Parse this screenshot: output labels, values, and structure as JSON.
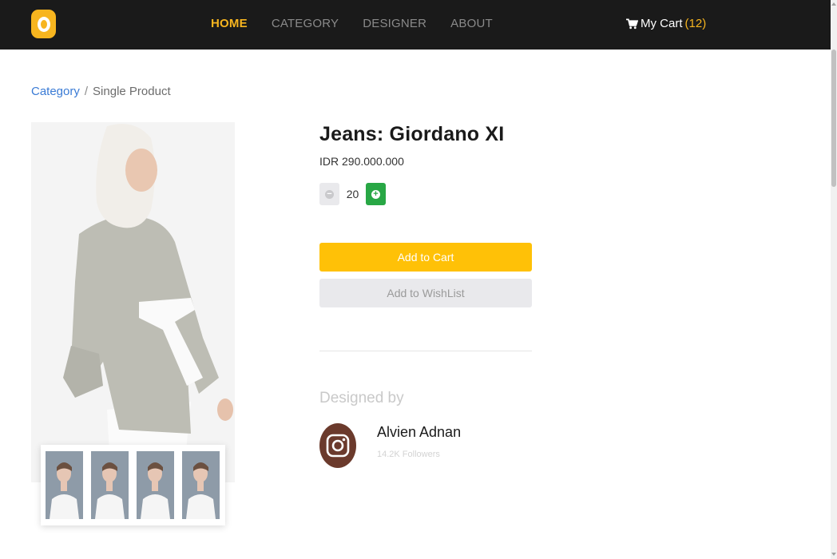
{
  "nav": {
    "links": [
      {
        "label": "HOME",
        "active": true
      },
      {
        "label": "CATEGORY",
        "active": false
      },
      {
        "label": "DESIGNER",
        "active": false
      },
      {
        "label": "ABOUT",
        "active": false
      }
    ],
    "cart_label": "My Cart",
    "cart_open": "(",
    "cart_count": "12",
    "cart_close": ")"
  },
  "breadcrumb": {
    "parent": "Category",
    "separator": "/",
    "current": "Single Product"
  },
  "product": {
    "title": "Jeans: Giordano XI",
    "price": "IDR 290.000.000",
    "quantity": "20",
    "add_to_cart": "Add to Cart",
    "add_to_wishlist": "Add to WishList"
  },
  "designer": {
    "heading": "Designed by",
    "name": "Alvien Adnan",
    "followers": "14.2K Followers"
  },
  "colors": {
    "accent": "#f7b51f",
    "navbar": "#1a1a1a",
    "cart_button": "#ffc107",
    "plus_button": "#28a745",
    "link": "#3a7bd5"
  },
  "icons": {
    "logo": "logo-icon",
    "cart": "cart-icon",
    "minus": "minus-icon",
    "plus": "plus-icon",
    "designer_avatar": "instagram-icon"
  }
}
